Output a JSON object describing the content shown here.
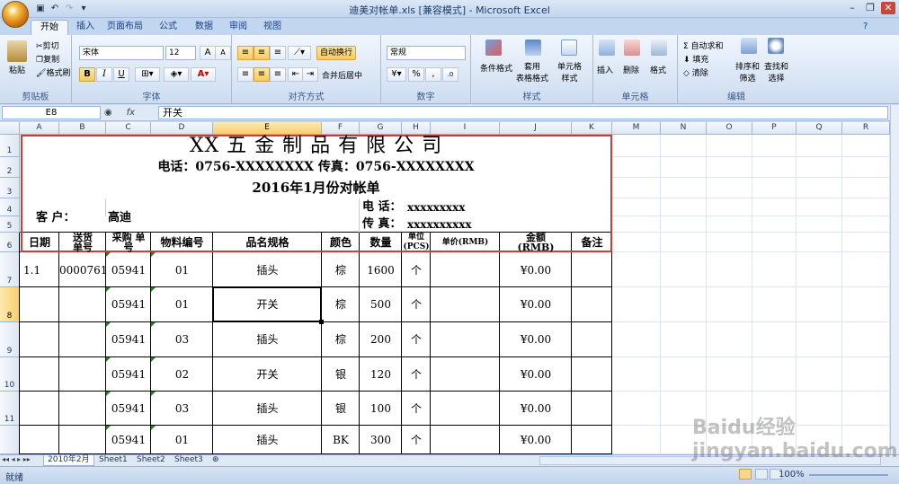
{
  "window": {
    "title": "迪美对帐单.xls  [兼容模式] - Microsoft Excel"
  },
  "ribbon_tabs": [
    "开始",
    "插入",
    "页面布局",
    "公式",
    "数据",
    "审阅",
    "视图"
  ],
  "clipboard": {
    "paste": "粘贴",
    "cut": "剪切",
    "copy": "复制",
    "format_painter": "格式刷",
    "label": "剪贴板"
  },
  "font": {
    "name": "宋体",
    "size": "12",
    "label": "字体",
    "bold": "B",
    "italic": "I",
    "underline": "U",
    "grow": "A",
    "shrink": "A",
    "color_a": "A"
  },
  "alignment": {
    "wrap": "自动换行",
    "merge": "合并后居中",
    "label": "对齐方式"
  },
  "number": {
    "format": "常规",
    "percent": "%",
    "comma": ",",
    "label": "数字"
  },
  "styles": {
    "conditional": "条件格式",
    "table": "套用\n表格格式",
    "cell": "单元格\n样式",
    "label": "样式"
  },
  "cells": {
    "insert": "插入",
    "delete": "删除",
    "format": "格式",
    "label": "单元格"
  },
  "editing": {
    "autosum": "Σ 自动求和",
    "fill": "填充",
    "clear": "清除",
    "sort": "排序和\n筛选",
    "find": "查找和\n选择",
    "label": "编辑"
  },
  "formula_bar": {
    "name_box": "E8",
    "fx": "fx",
    "content": "开关"
  },
  "columns": [
    "A",
    "B",
    "C",
    "D",
    "E",
    "F",
    "G",
    "H",
    "I",
    "J",
    "K",
    "M",
    "N",
    "O",
    "P",
    "Q",
    "R"
  ],
  "rows": [
    "1",
    "2",
    "3",
    "4",
    "5",
    "6",
    "7",
    "8",
    "9",
    "10",
    "11"
  ],
  "sheet": {
    "company": "XX 五 金 制 品 有 限 公 司",
    "phone_fax": "电话：0756-XXXXXXXX  传真：0756-XXXXXXXX",
    "statement_title": "2016年1月份对帐单",
    "customer_label": "客    户：",
    "customer_name": "高迪",
    "cust_phone_label": "电  话：",
    "cust_phone": "xxxxxxxxx",
    "cust_fax_label": "传  真：",
    "cust_fax": "xxxxxxxxxx",
    "headers": [
      "日期",
      "送货\n单号",
      "采购 单\n号",
      "物料编号",
      "品名规格",
      "颜色",
      "数量",
      "单位\n(PCS)",
      "单价(RMB)",
      "金额\n(RMB)",
      "备注"
    ],
    "items": [
      {
        "date": "1.1",
        "delivery": "0000761",
        "po": "05941",
        "material": "01",
        "name": "插头",
        "color": "棕",
        "qty": "1600",
        "unit": "个",
        "price": "",
        "amount": "¥0.00",
        "note": ""
      },
      {
        "date": "",
        "delivery": "",
        "po": "05941",
        "material": "01",
        "name": "开关",
        "color": "棕",
        "qty": "500",
        "unit": "个",
        "price": "",
        "amount": "¥0.00",
        "note": ""
      },
      {
        "date": "",
        "delivery": "",
        "po": "05941",
        "material": "03",
        "name": "插头",
        "color": "棕",
        "qty": "200",
        "unit": "个",
        "price": "",
        "amount": "¥0.00",
        "note": ""
      },
      {
        "date": "",
        "delivery": "",
        "po": "05941",
        "material": "02",
        "name": "开关",
        "color": "银",
        "qty": "120",
        "unit": "个",
        "price": "",
        "amount": "¥0.00",
        "note": ""
      },
      {
        "date": "",
        "delivery": "",
        "po": "05941",
        "material": "03",
        "name": "插头",
        "color": "银",
        "qty": "100",
        "unit": "个",
        "price": "",
        "amount": "¥0.00",
        "note": ""
      },
      {
        "date": "",
        "delivery": "",
        "po": "05941",
        "material": "01",
        "name": "插头",
        "color": "BK",
        "qty": "300",
        "unit": "个",
        "price": "",
        "amount": "¥0.00",
        "note": ""
      }
    ]
  },
  "sheet_tabs": [
    "2010年2月",
    "Sheet1",
    "Sheet2",
    "Sheet3"
  ],
  "status": {
    "ready": "就绪",
    "zoom": "100%"
  },
  "watermark": "Baidu经验 jingyan.baidu.com"
}
